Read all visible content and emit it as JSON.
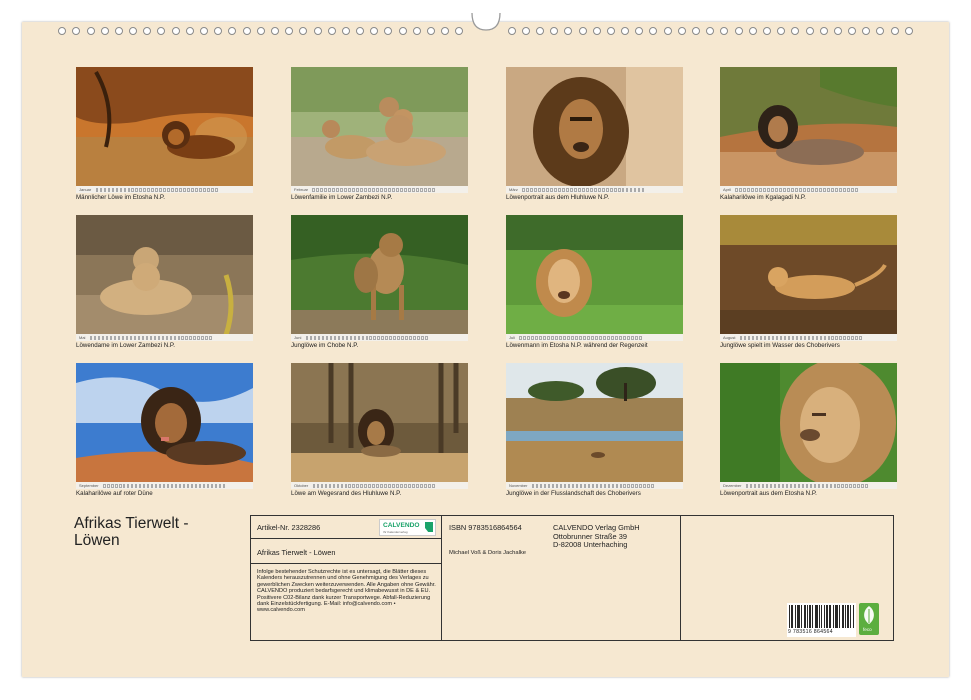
{
  "calendar": {
    "title_line1": "Afrikas Tierwelt -",
    "title_line2": "Löwen"
  },
  "photos": [
    {
      "month": "Januar",
      "caption": "Männlicher Löwe im Etosha N.P."
    },
    {
      "month": "Februar",
      "caption": "Löwenfamilie im Lower Zambezi N.P."
    },
    {
      "month": "März",
      "caption": "Löwenportrait aus dem Hluhluwe N.P."
    },
    {
      "month": "April",
      "caption": "Kalaharilöwe im Kgalagadi N.P."
    },
    {
      "month": "Mai",
      "caption": "Löwendame im Lower Zambezi N.P."
    },
    {
      "month": "Juni",
      "caption": "Junglöwe im Chobe N.P."
    },
    {
      "month": "Juli",
      "caption": "Löwenmann im Etosha N.P. während der Regenzeit"
    },
    {
      "month": "August",
      "caption": "Junglöwe spielt im Wasser des Choberivers"
    },
    {
      "month": "September",
      "caption": "Kalaharilöwe auf roter Düne"
    },
    {
      "month": "Oktober",
      "caption": "Löwe am Wegesrand des Hluhluwe N.P."
    },
    {
      "month": "November",
      "caption": "Junglöwe in der Flusslandschaft des Choberivers"
    },
    {
      "month": "Dezember",
      "caption": "Löwenportrait aus dem Etosha N.P."
    }
  ],
  "info": {
    "article_no": "Artikel-Nr. 2328286",
    "product_title": "Afrikas Tierwelt - Löwen",
    "brand": "CALVENDO",
    "brand_tagline": "Ihr Kalenderverlag",
    "legal_text": "Infolge bestehender Schutzrechte ist es untersagt, die Blätter dieses Kalenders herauszutrennen und ohne Genehmigung des Verlages zu gewerblichen Zwecken weiterzuverwenden. Alle Angaben ohne Gewähr. CALVENDO produziert bedarfsgerecht und klimabewusst in DE & EU. Positivere C02-Bilanz dank kurzer Transportwege. Abfall-Reduzierung dank Einzelstückfertigung. E-Mail: info@calvendo.com • www.calvendo.com",
    "isbn": "ISBN 9783516864564",
    "authors": "Michael Voß & Doris Jachalke",
    "publisher_name": "CALVENDO Verlag GmbH",
    "publisher_street": "Ottobrunner Straße 39",
    "publisher_city": "D-82008 Unterhaching",
    "barcode_digits": "9 783516 864564",
    "eco_label": "feco"
  },
  "colors": {
    "page_background": "#f6e8d1",
    "calvendo_accent": "#1aa36a",
    "eco_green": "#5cae3f"
  }
}
